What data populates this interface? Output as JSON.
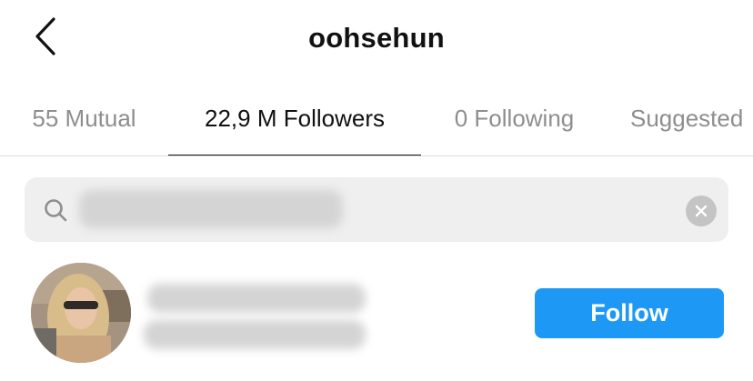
{
  "header": {
    "title": "oohsehun",
    "back_icon": "chevron-left-icon"
  },
  "tabs": [
    {
      "label": "55 Mutual",
      "active": false
    },
    {
      "label": "22,9 M Followers",
      "active": true
    },
    {
      "label": "0 Following",
      "active": false
    },
    {
      "label": "Suggested",
      "active": false
    }
  ],
  "search": {
    "value": "",
    "search_icon": "search-icon",
    "clear_icon": "clear-icon"
  },
  "list": [
    {
      "follow_label": "Follow"
    }
  ],
  "colors": {
    "accent": "#1e98f5",
    "inactive_tab": "#8e8e8e",
    "search_bg": "#efefef"
  }
}
